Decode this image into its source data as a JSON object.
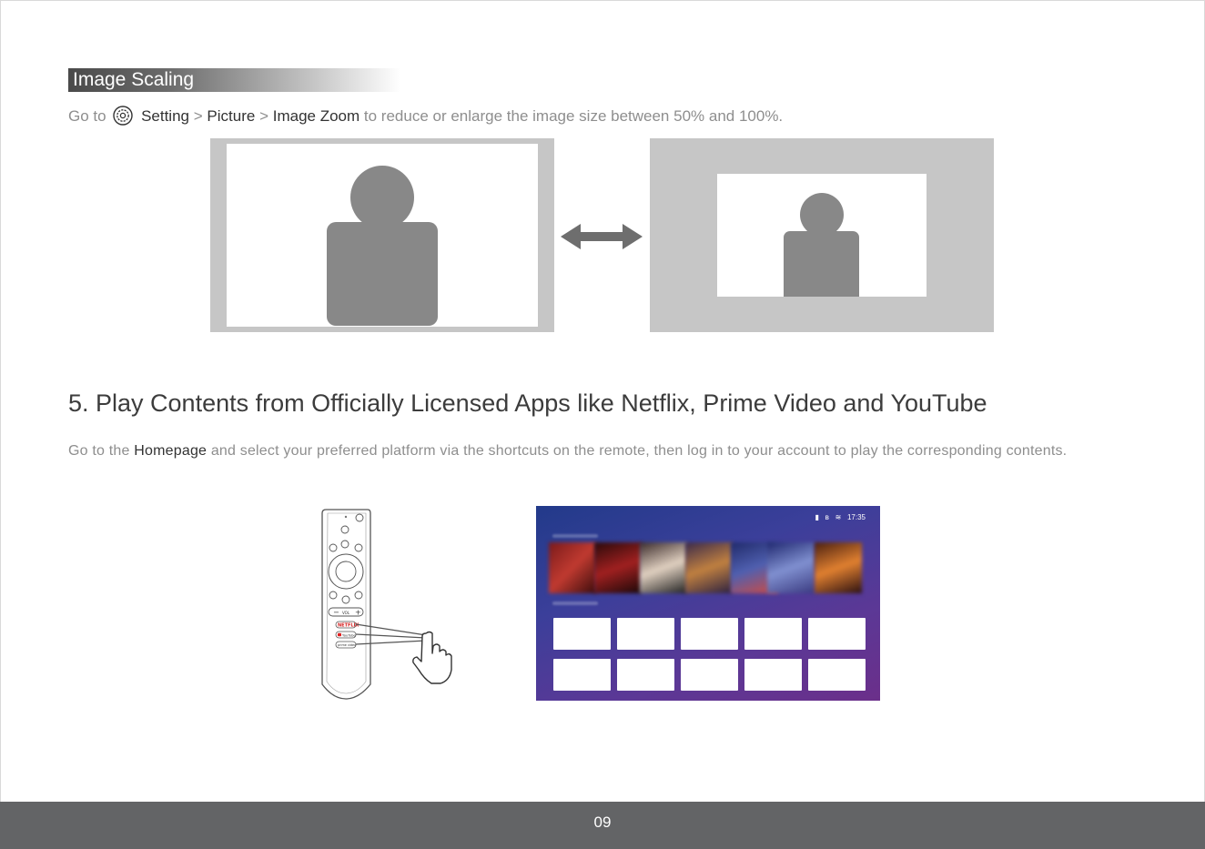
{
  "section": {
    "title": "Image Scaling"
  },
  "image_zoom": {
    "go_to": "Go to",
    "setting": "Setting",
    "sep1": ">",
    "picture": "Picture",
    "sep2": ">",
    "image_zoom": "Image Zoom",
    "rest": "to reduce or enlarge the image size between 50% and 100%."
  },
  "heading": "5. Play Contents from Officially Licensed Apps like Netflix, Prime Video and YouTube",
  "paragraph": {
    "part1": "Go to the",
    "homepage": "Homepage",
    "part2": "and select your preferred platform via the shortcuts on the remote, then log in to your account to play the corresponding contents."
  },
  "remote": {
    "vol_label": "VOL",
    "vol_minus": "−",
    "vol_plus": "+",
    "netflix_button": "NETFLIX",
    "youtube_button": "YouTube",
    "prime_button": "prime video"
  },
  "tv_screen": {
    "clock": "17:35"
  },
  "footer": {
    "page_number": "09"
  },
  "colors": {
    "frame_gray": "#c6c6c6",
    "person_gray": "#888888",
    "footer": "#636466",
    "accent_text": "#333333"
  }
}
